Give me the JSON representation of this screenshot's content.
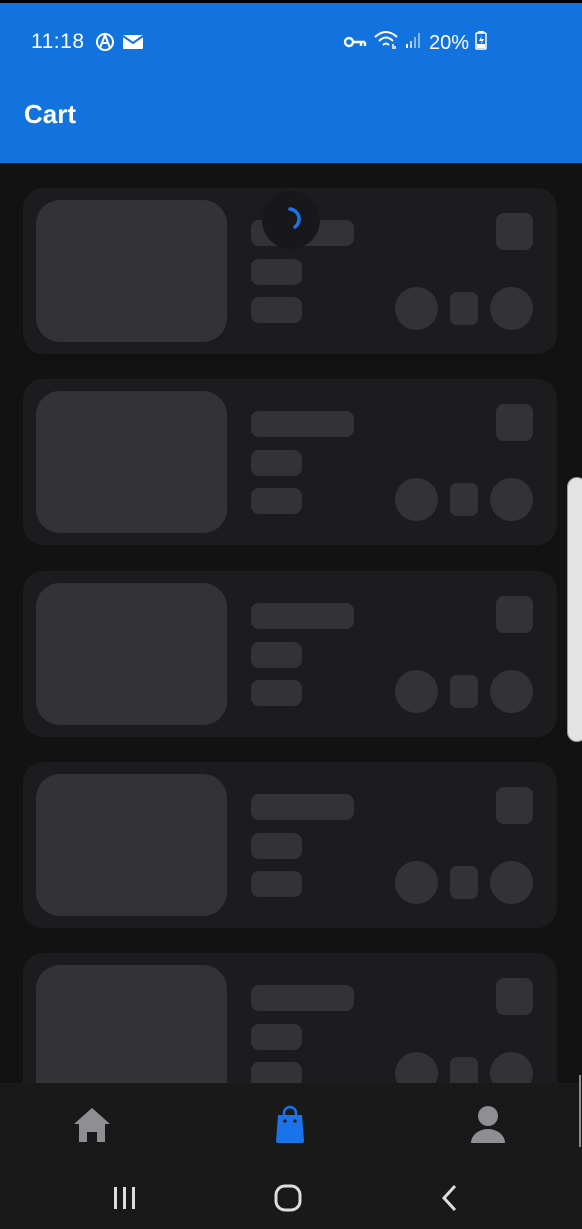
{
  "status_bar": {
    "time": "11:18",
    "battery": "20%",
    "left_icons": [
      "android-debug-icon",
      "mail-icon"
    ],
    "right_icons": [
      "vpn-key-icon",
      "wifi-icon",
      "signal-icon",
      "battery-charging-icon"
    ]
  },
  "header": {
    "title": "Cart",
    "background_color": "#1273de"
  },
  "cart": {
    "state": "loading",
    "skeleton_item_count": 5
  },
  "bottom_nav": {
    "items": [
      {
        "name": "home",
        "icon": "home-icon",
        "active": false
      },
      {
        "name": "cart",
        "icon": "shopping-bag-icon",
        "active": true
      },
      {
        "name": "profile",
        "icon": "person-icon",
        "active": false
      }
    ],
    "active_color": "#1a73e8",
    "inactive_color": "#8e8e93"
  },
  "system_nav": {
    "buttons": [
      "recents-icon",
      "home-circle-icon",
      "back-icon"
    ]
  }
}
